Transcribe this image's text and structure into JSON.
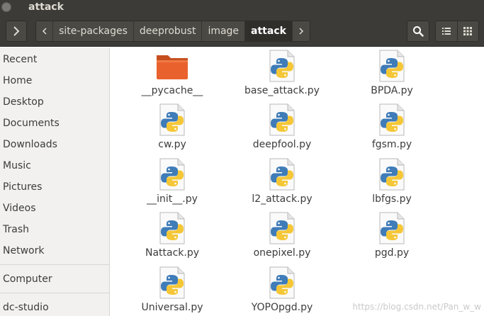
{
  "window": {
    "title": "attack"
  },
  "toolbar": {
    "forward_icon": "chevron-right-icon",
    "path_left_icon": "chevron-left-icon",
    "path_right_icon": "chevron-right-icon",
    "search_icon": "search-icon",
    "list_view_icon": "list-view-icon",
    "grid_view_icon": "grid-view-icon"
  },
  "breadcrumbs": [
    "site-packages",
    "deeprobust",
    "image",
    "attack"
  ],
  "sidebar": {
    "items": [
      "Recent",
      "Home",
      "Desktop",
      "Documents",
      "Downloads",
      "Music",
      "Pictures",
      "Videos",
      "Trash",
      "Network"
    ],
    "devices": [
      "Computer",
      "dc-studio"
    ]
  },
  "files": [
    {
      "name": "__pycache__",
      "kind": "folder"
    },
    {
      "name": "base_attack.py",
      "kind": "python"
    },
    {
      "name": "BPDA.py",
      "kind": "python"
    },
    {
      "name": "cw.py",
      "kind": "python"
    },
    {
      "name": "deepfool.py",
      "kind": "python"
    },
    {
      "name": "fgsm.py",
      "kind": "python"
    },
    {
      "name": "__init__.py",
      "kind": "python"
    },
    {
      "name": "l2_attack.py",
      "kind": "python"
    },
    {
      "name": "lbfgs.py",
      "kind": "python"
    },
    {
      "name": "Nattack.py",
      "kind": "python"
    },
    {
      "name": "onepixel.py",
      "kind": "python"
    },
    {
      "name": "pgd.py",
      "kind": "python"
    },
    {
      "name": "Universal.py",
      "kind": "python"
    },
    {
      "name": "YOPOpgd.py",
      "kind": "python"
    }
  ],
  "watermark": "https://blog.csdn.net/Pan_w_w",
  "colors": {
    "titlebar": "#3c3b37",
    "folder": "#e9622d",
    "sidebar": "#f2f1f0"
  }
}
